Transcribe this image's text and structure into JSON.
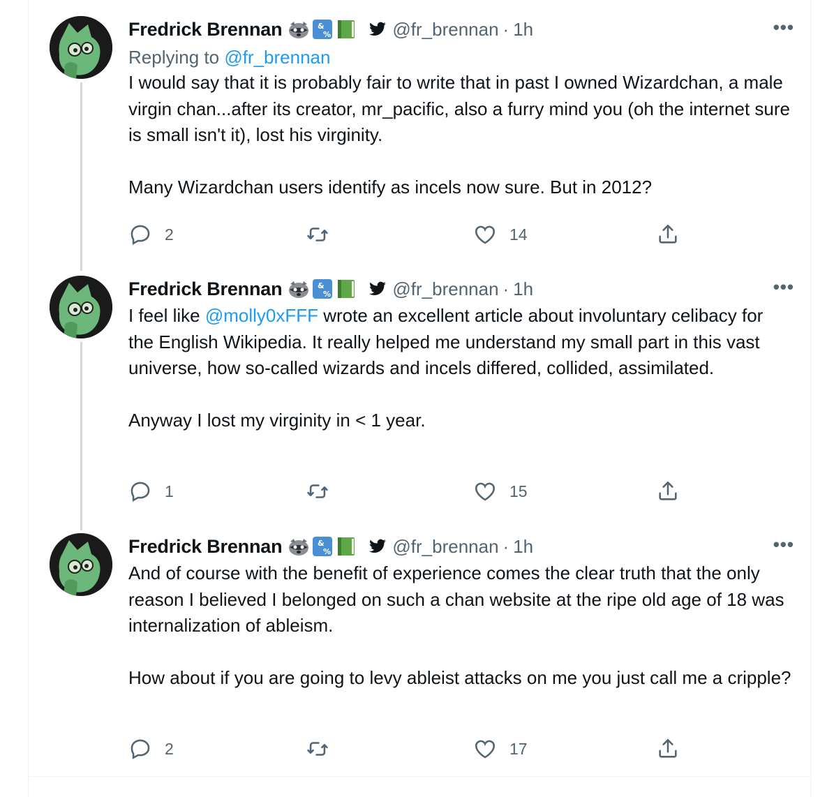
{
  "tweets": [
    {
      "author": "Fredrick Brennan",
      "handle": "@fr_brennan",
      "time": "1h",
      "replying_prefix": "Replying to ",
      "replying_handle": "@fr_brennan",
      "text": "I would say that it is probably fair to write that in past I owned Wizardchan, a male virgin chan...after its creator, mr_pacific, also a furry mind you (oh the internet sure is small isn't it), lost his virginity.\n\nMany Wizardchan users identify as incels now sure. But in 2012?",
      "replies": "2",
      "likes": "14"
    },
    {
      "author": "Fredrick Brennan",
      "handle": "@fr_brennan",
      "time": "1h",
      "text_before": "I feel like ",
      "mention": "@molly0xFFF",
      "text_after": " wrote an excellent article about involuntary celibacy for the English Wikipedia. It really helped me understand my small part in this vast universe, how so-called wizards and incels differed, collided, assimilated.\n\nAnyway I lost my virginity in < 1 year.",
      "replies": "1",
      "likes": "15"
    },
    {
      "author": "Fredrick Brennan",
      "handle": "@fr_brennan",
      "time": "1h",
      "text": "And of course with the benefit of experience comes the clear truth that the only reason I believed I belonged on such a chan website at the ripe old age of 18 was internalization of ableism.\n\nHow about if you are going to levy ableist attacks on me you just call me a cripple?",
      "replies": "2",
      "likes": "17"
    }
  ],
  "ui": {
    "dot_separator": "·",
    "more_glyph": "•••"
  },
  "icons": [
    "raccoon-emoji",
    "symbols-emoji",
    "green-book-emoji",
    "twitter-bird-icon",
    "reply-icon",
    "retweet-icon",
    "like-icon",
    "share-icon",
    "more-icon"
  ],
  "colors": {
    "link": "#1d9bf0",
    "secondary": "#536471",
    "avatar_green": "#5fa86b",
    "thread_line": "#cfd9de"
  }
}
